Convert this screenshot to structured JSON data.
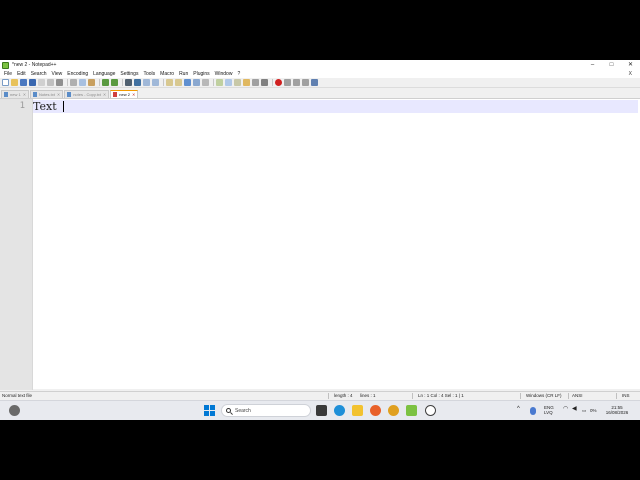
{
  "window": {
    "title": "*new 2 - Notepad++",
    "minimize": "–",
    "maximize": "□",
    "close": "✕"
  },
  "menu": {
    "items": [
      "File",
      "Edit",
      "Search",
      "View",
      "Encoding",
      "Language",
      "Settings",
      "Tools",
      "Macro",
      "Run",
      "Plugins",
      "Window",
      "?"
    ],
    "close": "X"
  },
  "toolbar": {
    "icons": [
      "new-file-icon",
      "open-file-icon",
      "save-icon",
      "save-all-icon",
      "close-icon",
      "close-all-icon",
      "print-icon",
      "cut-icon",
      "copy-icon",
      "paste-icon",
      "undo-icon",
      "redo-icon",
      "find-icon",
      "replace-icon",
      "zoom-in-icon",
      "zoom-out-icon",
      "sync-v-icon",
      "sync-h-icon",
      "word-wrap-icon",
      "all-chars-icon",
      "indent-guide-icon",
      "lang-icon",
      "map-icon",
      "function-list-icon",
      "folder-icon",
      "monitor-icon",
      "record-icon",
      "stop-icon",
      "play-icon",
      "play-multi-icon",
      "save-macro-icon"
    ]
  },
  "tabs": [
    {
      "label": "new 1",
      "active": false
    },
    {
      "label": "Notes.txt",
      "active": false
    },
    {
      "label": "notes - Copy.txt",
      "active": false
    },
    {
      "label": "new 2",
      "active": true
    }
  ],
  "editor": {
    "line_number": "1",
    "text": "Text"
  },
  "statusbar": {
    "file_type": "Normal text file",
    "length": "length : 4",
    "lines": "lines : 1",
    "position": "Ln : 1    Col : 4    Sel : 1 | 1",
    "eol": "Windows (CR LF)",
    "encoding": "ANSI",
    "mode": "INS"
  },
  "taskbar": {
    "search_placeholder": "Search",
    "language_line1": "ENG",
    "language_line2": "LVQ",
    "battery": "0%",
    "time": "21:55",
    "date": "16/08/2026"
  },
  "colors": {
    "accent": "#0078d4",
    "current_line": "#e8e8ff",
    "active_tab_top": "#f29900"
  }
}
